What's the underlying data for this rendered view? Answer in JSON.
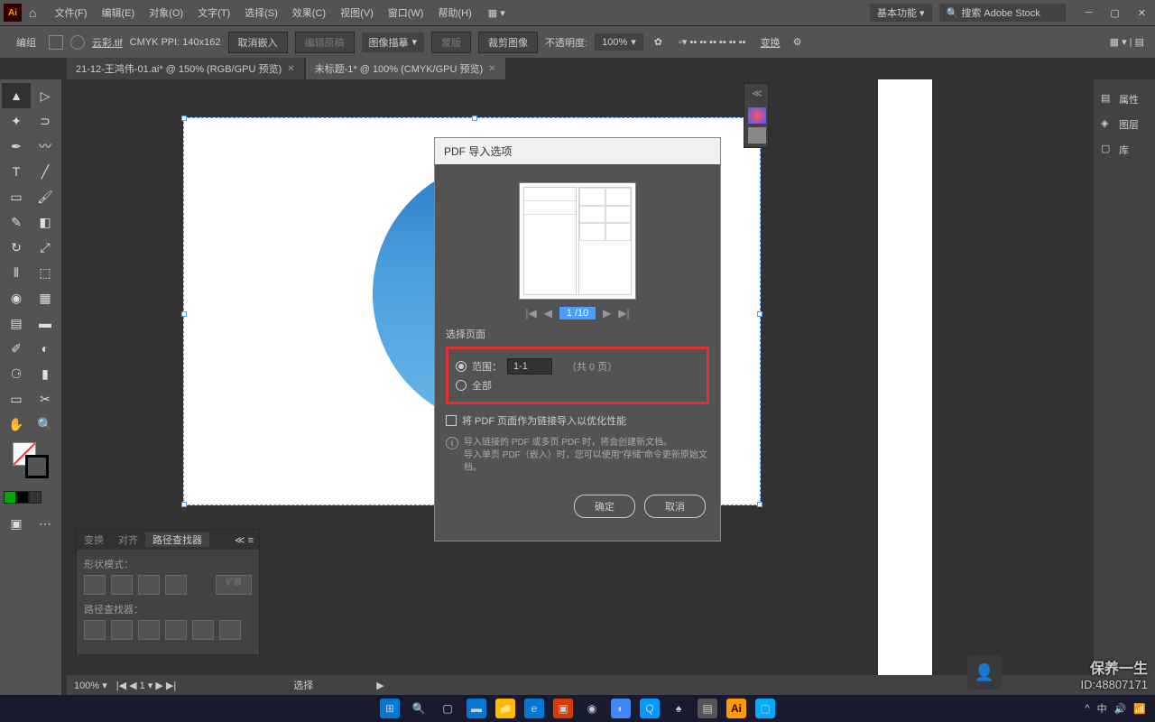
{
  "menus": [
    "文件(F)",
    "编辑(E)",
    "对象(O)",
    "文字(T)",
    "选择(S)",
    "效果(C)",
    "视图(V)",
    "窗口(W)",
    "帮助(H)"
  ],
  "workspace": "基本功能",
  "search_placeholder": "搜索 Adobe Stock",
  "control": {
    "mode": "编组",
    "filename": "云彩.tif",
    "colormode": "CMYK PPI: 140x162",
    "btn_cancel_embed": "取消嵌入",
    "btn_image_trace": "图像描摹",
    "btn_crop": "裁剪图像",
    "opacity_label": "不透明度:",
    "opacity_value": "100%",
    "transform": "变换"
  },
  "tabs": [
    {
      "label": "21-12-王鸿伟-01.ai* @ 150% (RGB/GPU 预览)",
      "active": false
    },
    {
      "label": "未标题-1* @ 100% (CMYK/GPU 预览)",
      "active": true
    }
  ],
  "right_panels": [
    "属性",
    "图层",
    "库"
  ],
  "pathfinder": {
    "tabs": [
      "变换",
      "对齐",
      "路径查找器"
    ],
    "shape_mode": "形状模式：",
    "pathfinders": "路径查找器："
  },
  "dialog": {
    "title": "PDF 导入选项",
    "page_value": "1 /10",
    "section": "选择页面",
    "range_label": "范围：",
    "range_value": "1-1",
    "range_suffix": "（共   0 页）",
    "all_label": "全部",
    "checkbox_label": "将 PDF 页面作为链接导入以优化性能",
    "info1": "导入链接的 PDF 或多页 PDF 时，将会创建新文档。",
    "info2": "导入单页 PDF（嵌入）时，您可以使用\"存储\"命令更新原始文档。",
    "ok": "确定",
    "cancel": "取消"
  },
  "status": {
    "zoom": "100%",
    "page": "1",
    "tool": "选择"
  },
  "watermark": {
    "brand": "保养一生",
    "id": "ID:48807171"
  }
}
